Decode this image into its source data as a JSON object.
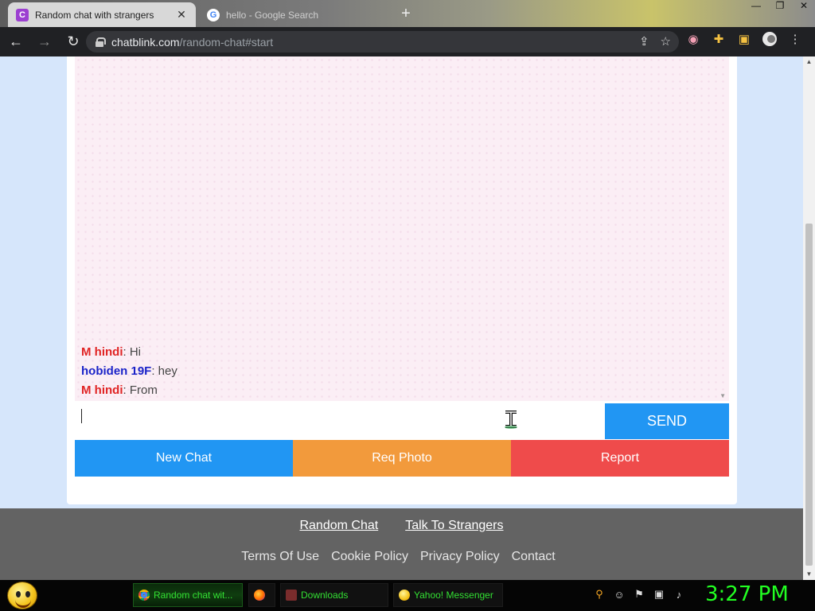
{
  "browser": {
    "tabs": [
      {
        "title": "Random chat with strangers",
        "favicon": "C",
        "active": true
      },
      {
        "title": "hello - Google Search",
        "favicon": "G",
        "active": false
      }
    ],
    "new_tab": "+",
    "url_host": "chatblink.com",
    "url_path": "/random-chat#start"
  },
  "chat": {
    "messages": [
      {
        "user": "M hindi",
        "text": ": Hi",
        "gender": "male"
      },
      {
        "user": "hobiden 19F",
        "text": ": hey",
        "gender": "female"
      },
      {
        "user": "M hindi",
        "text": ": From",
        "gender": "male"
      }
    ],
    "input_value": "",
    "send_label": "SEND"
  },
  "actions": {
    "new_chat": "New Chat",
    "req_photo": "Req Photo",
    "report": "Report"
  },
  "footer": {
    "primary_links": [
      "Random Chat",
      "Talk To Strangers"
    ],
    "secondary_links": [
      "Terms Of Use",
      "Cookie Policy",
      "Privacy Policy",
      "Contact"
    ]
  },
  "taskbar": {
    "tasks": [
      {
        "label": "Random chat wit...",
        "icon": "chrome-icon",
        "active": true
      },
      {
        "label": "",
        "icon": "firefox-icon",
        "active": false
      },
      {
        "label": "Downloads",
        "icon": "downloads-icon",
        "active": false
      },
      {
        "label": "Yahoo! Messenger",
        "icon": "yahoo-messenger-icon",
        "active": false
      }
    ],
    "clock": "3:27 PM"
  },
  "colors": {
    "send": "#2196f3",
    "new_chat": "#2196f3",
    "req_photo": "#f29a3c",
    "report": "#ef4b4b",
    "male_user": "#e02424",
    "female_user": "#1a23c8",
    "clock": "#22ff22"
  }
}
